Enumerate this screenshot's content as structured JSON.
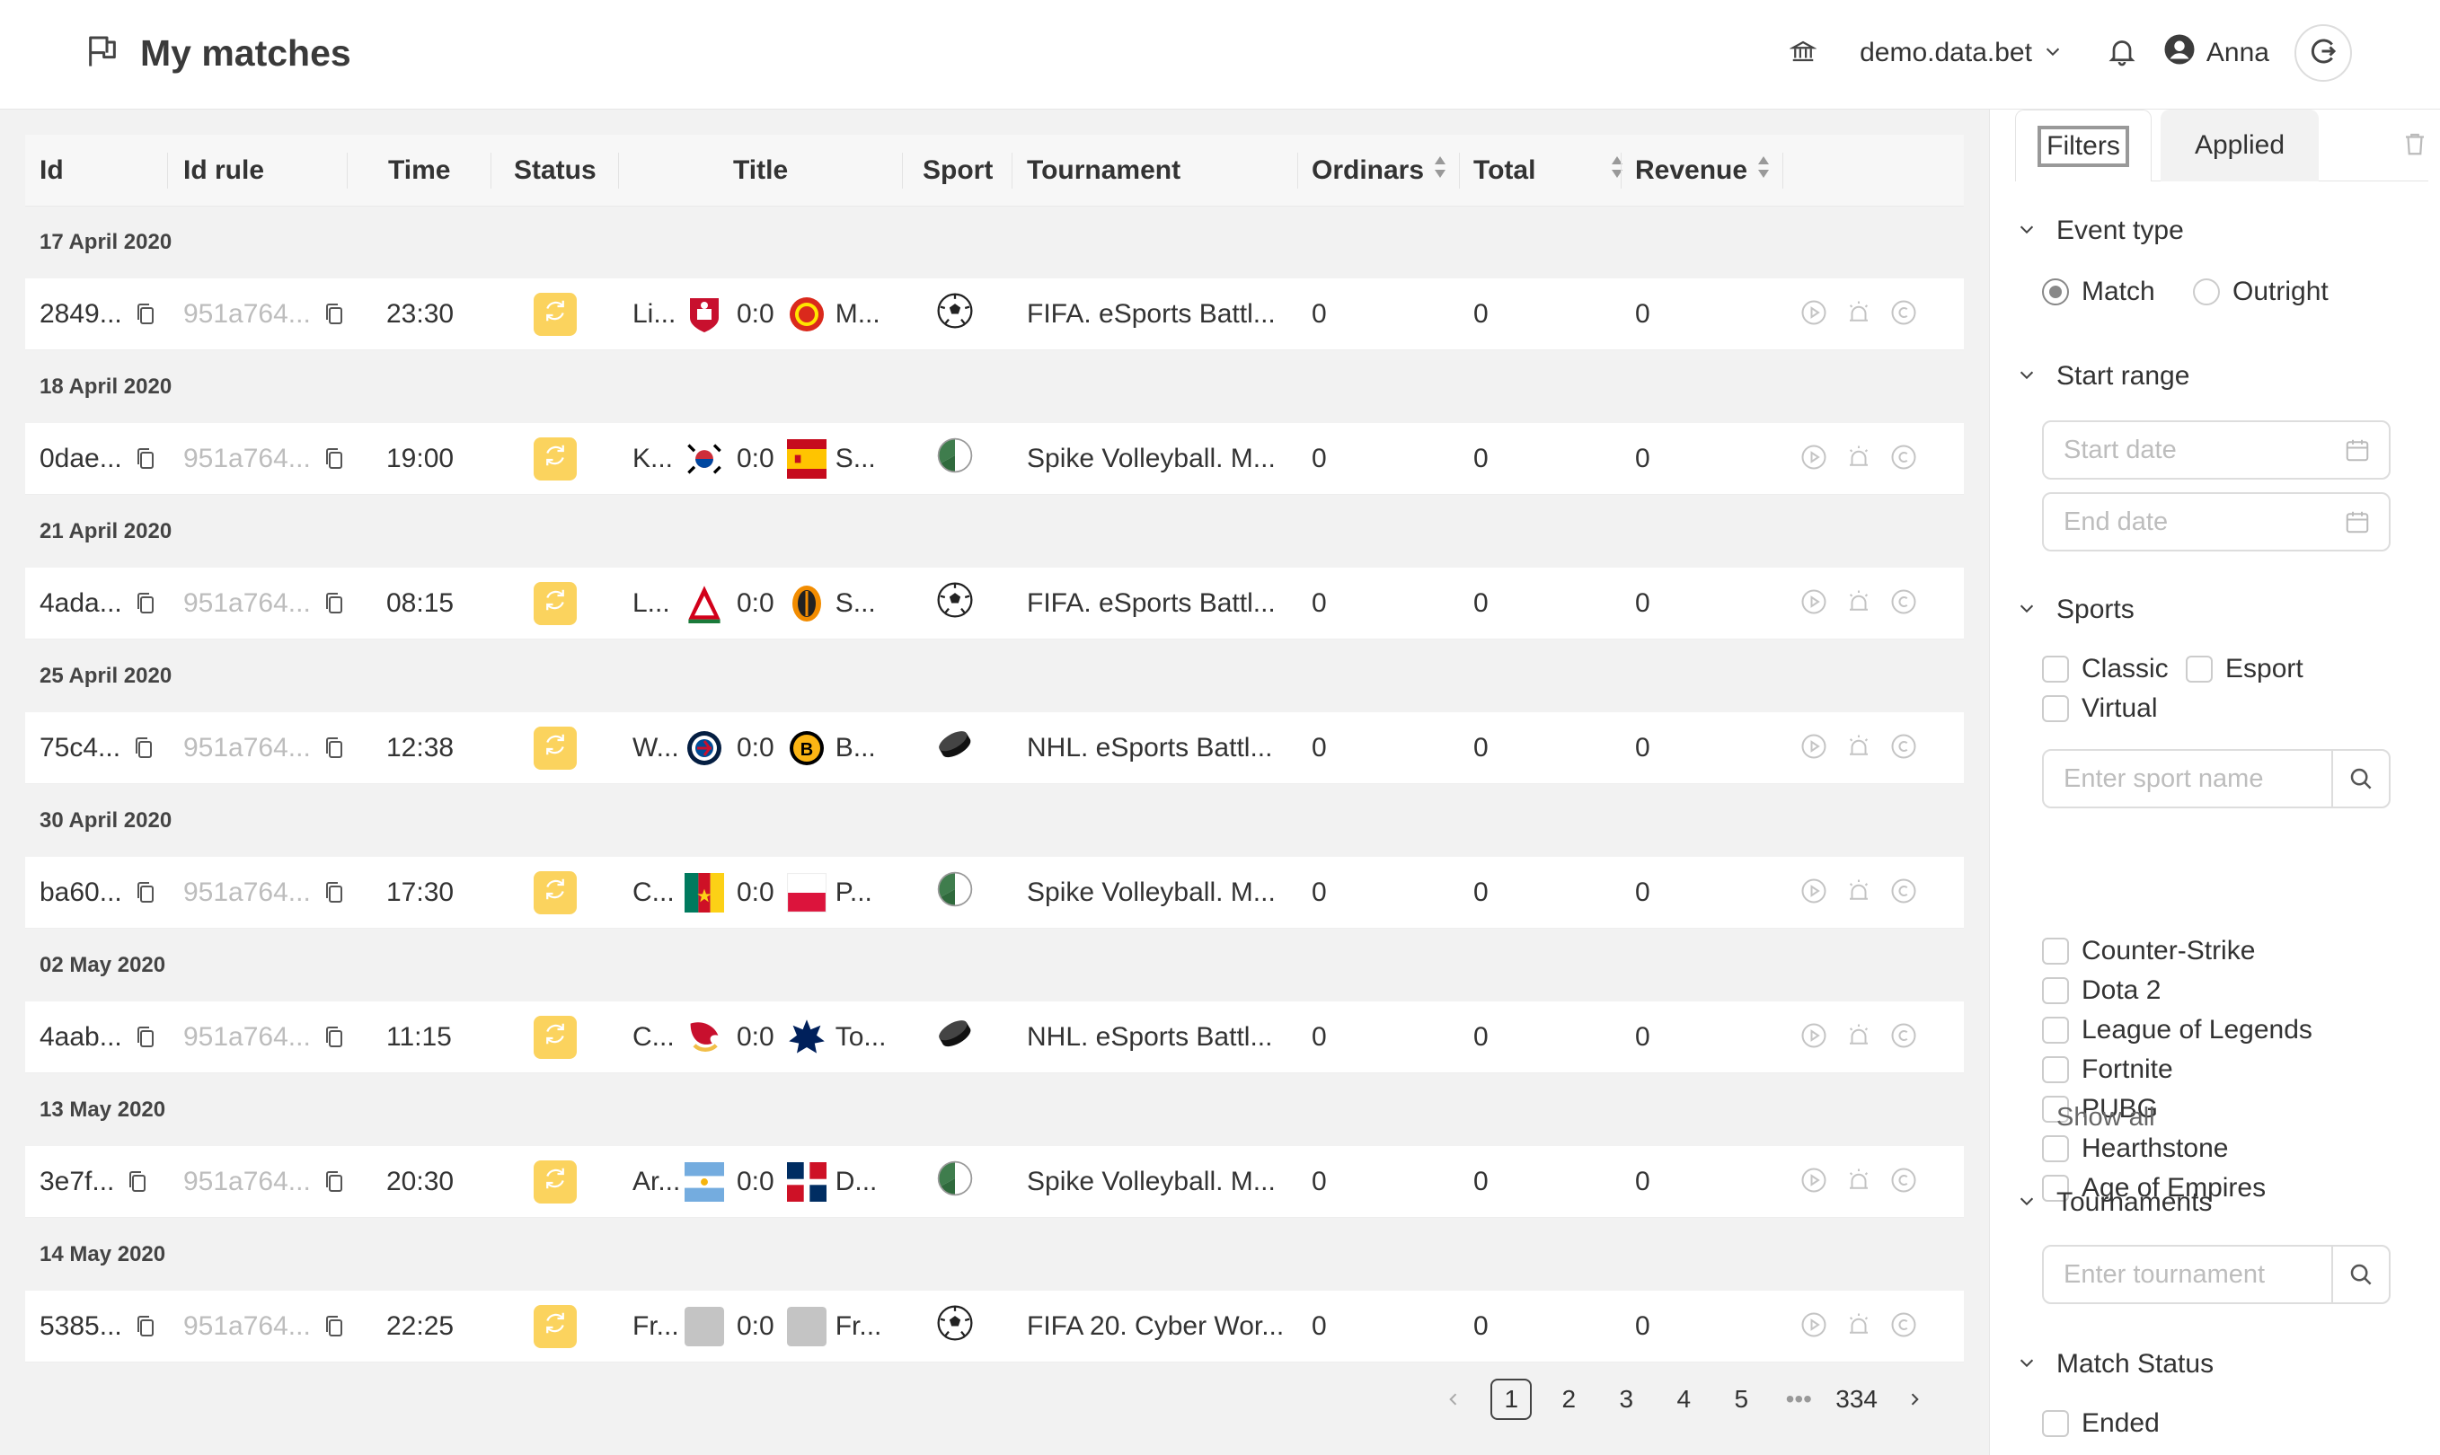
{
  "header": {
    "title": "My matches",
    "domain": "demo.data.bet",
    "user": "Anna"
  },
  "table": {
    "columns": [
      "Id",
      "Id rule",
      "Time",
      "Status",
      "Title",
      "Sport",
      "Tournament",
      "Ordinars",
      "Total",
      "Revenue"
    ],
    "groups": [
      {
        "date": "17 April 2020",
        "row": {
          "id": "2849...",
          "idrule": "951a764...",
          "time": "23:30",
          "home": "Li...",
          "score": "0:0",
          "away": "M...",
          "sport": "soccer",
          "tournament": "FIFA. eSports Battl...",
          "ordinars": "0",
          "total": "0",
          "revenue": "0"
        }
      },
      {
        "date": "18 April 2020",
        "row": {
          "id": "0dae...",
          "idrule": "951a764...",
          "time": "19:00",
          "home": "K...",
          "score": "0:0",
          "away": "S...",
          "sport": "volleyball",
          "tournament": "Spike Volleyball. M...",
          "ordinars": "0",
          "total": "0",
          "revenue": "0"
        }
      },
      {
        "date": "21 April 2020",
        "row": {
          "id": "4ada...",
          "idrule": "951a764...",
          "time": "08:15",
          "home": "L...",
          "score": "0:0",
          "away": "S...",
          "sport": "soccer",
          "tournament": "FIFA. eSports Battl...",
          "ordinars": "0",
          "total": "0",
          "revenue": "0"
        }
      },
      {
        "date": "25 April 2020",
        "row": {
          "id": "75c4...",
          "idrule": "951a764...",
          "time": "12:38",
          "home": "W...",
          "score": "0:0",
          "away": "B...",
          "sport": "hockey",
          "tournament": "NHL. eSports Battl...",
          "ordinars": "0",
          "total": "0",
          "revenue": "0"
        }
      },
      {
        "date": "30 April 2020",
        "row": {
          "id": "ba60...",
          "idrule": "951a764...",
          "time": "17:30",
          "home": "C...",
          "score": "0:0",
          "away": "P...",
          "sport": "volleyball",
          "tournament": "Spike Volleyball. M...",
          "ordinars": "0",
          "total": "0",
          "revenue": "0"
        }
      },
      {
        "date": "02 May 2020",
        "row": {
          "id": "4aab...",
          "idrule": "951a764...",
          "time": "11:15",
          "home": "C...",
          "score": "0:0",
          "away": "To...",
          "sport": "hockey",
          "tournament": "NHL. eSports Battl...",
          "ordinars": "0",
          "total": "0",
          "revenue": "0"
        }
      },
      {
        "date": "13 May 2020",
        "row": {
          "id": "3e7f...",
          "idrule": "951a764...",
          "time": "20:30",
          "home": "Ar...",
          "score": "0:0",
          "away": "D...",
          "sport": "volleyball",
          "tournament": "Spike Volleyball. M...",
          "ordinars": "0",
          "total": "0",
          "revenue": "0"
        }
      },
      {
        "date": "14 May 2020",
        "row": {
          "id": "5385...",
          "idrule": "951a764...",
          "time": "22:25",
          "home": "Fr...",
          "score": "0:0",
          "away": "Fr...",
          "sport": "soccer",
          "tournament": "FIFA 20. Cyber Wor...",
          "ordinars": "0",
          "total": "0",
          "revenue": "0"
        }
      }
    ]
  },
  "pagination": {
    "pages": [
      "1",
      "2",
      "3",
      "4",
      "5"
    ],
    "ellipsis": "•••",
    "last": "334",
    "current": "1"
  },
  "sidebar": {
    "tabs": {
      "filters": "Filters",
      "applied": "Applied"
    },
    "event_type": {
      "title": "Event type",
      "match": "Match",
      "outright": "Outright"
    },
    "start_range": {
      "title": "Start range",
      "start_placeholder": "Start date",
      "end_placeholder": "End date"
    },
    "sports": {
      "title": "Sports",
      "classic": "Classic",
      "esport": "Esport",
      "virtual": "Virtual",
      "search_placeholder": "Enter sport name",
      "items": [
        "Counter-Strike",
        "Dota 2",
        "League of Legends",
        "Fortnite",
        "PUBG",
        "Hearthstone",
        "Age of Empires"
      ],
      "show_all": "Show all"
    },
    "tournaments": {
      "title": "Tournaments",
      "search_placeholder": "Enter tournament"
    },
    "match_status": {
      "title": "Match Status",
      "ended": "Ended"
    }
  }
}
